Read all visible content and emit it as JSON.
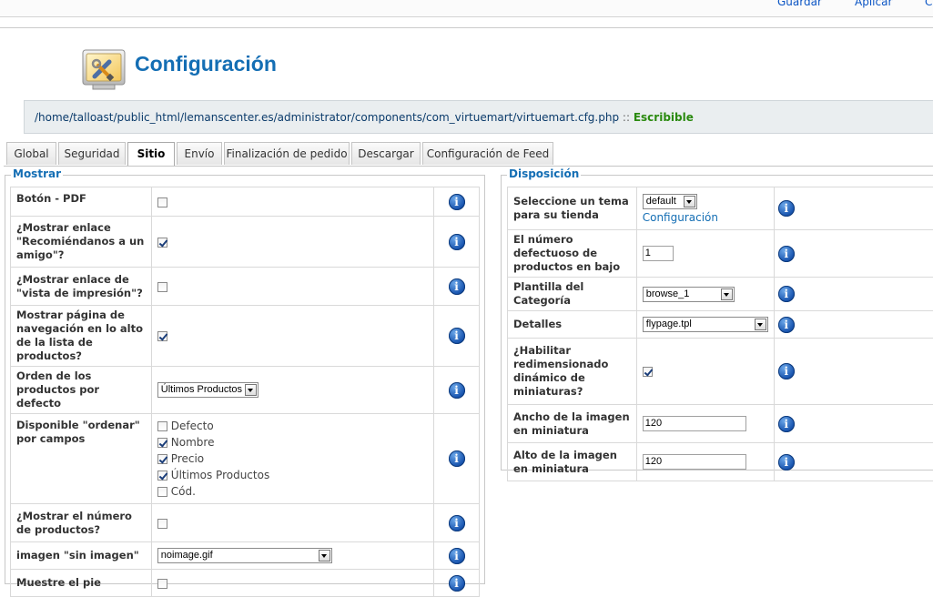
{
  "toolbar": {
    "save": "Guardar",
    "apply": "Aplicar",
    "cancel": "C"
  },
  "page": {
    "title": "Configuración",
    "path": "/home/talloast/public_html/lemanscenter.es/administrator/components/com_virtuemart/virtuemart.cfg.php",
    "path_sep": "::",
    "path_status": "Escribible"
  },
  "tabs": [
    {
      "label": "Global"
    },
    {
      "label": "Seguridad"
    },
    {
      "label": "Sitio"
    },
    {
      "label": "Envío"
    },
    {
      "label": "Finalización de pedido"
    },
    {
      "label": "Descargar"
    },
    {
      "label": "Configuración de Feed"
    }
  ],
  "mostrar": {
    "legend": "Mostrar",
    "rows": [
      {
        "label": "Botón - PDF",
        "checked": false
      },
      {
        "label": "¿Mostrar enlace \"Recomiéndanos a un amigo\"?",
        "checked": true
      },
      {
        "label": "¿Mostrar enlace de \"vista de impresión\"?",
        "checked": false
      },
      {
        "label": "Mostrar página de navegación en lo alto de la lista de productos?",
        "checked": true
      },
      {
        "label": "Orden de los productos por defecto",
        "select": "Últimos Productos"
      },
      {
        "label": "Disponible \"ordenar\" por campos",
        "options": [
          {
            "label": "Defecto",
            "checked": false
          },
          {
            "label": "Nombre",
            "checked": true
          },
          {
            "label": "Precio",
            "checked": true
          },
          {
            "label": "Últimos Productos",
            "checked": true
          },
          {
            "label": "Cód.",
            "checked": false
          }
        ]
      },
      {
        "label": "¿Mostrar el número de productos?",
        "checked": false
      },
      {
        "label": "imagen \"sin imagen\"",
        "select": "noimage.gif"
      },
      {
        "label": "Muestre el pie",
        "checked": false
      }
    ]
  },
  "disposicion": {
    "legend": "Disposición",
    "rows": [
      {
        "label": "Seleccione un tema para su tienda",
        "select": "default",
        "link": "Configuración"
      },
      {
        "label": "El número defectuoso de productos en bajo",
        "input": "1"
      },
      {
        "label": "Plantilla del Categoría",
        "select": "browse_1"
      },
      {
        "label": "Detalles",
        "select": "flypage.tpl"
      },
      {
        "label": "¿Habilitar redimensionado dinámico de miniaturas?",
        "checked": true
      },
      {
        "label": "Ancho de la imagen en miniatura",
        "input": "120"
      },
      {
        "label": "Alto de la imagen en miniatura",
        "input": "120"
      }
    ]
  },
  "info_glyph": "i",
  "colors": {
    "accent": "#146eb4",
    "writable": "#2a8a0f"
  }
}
